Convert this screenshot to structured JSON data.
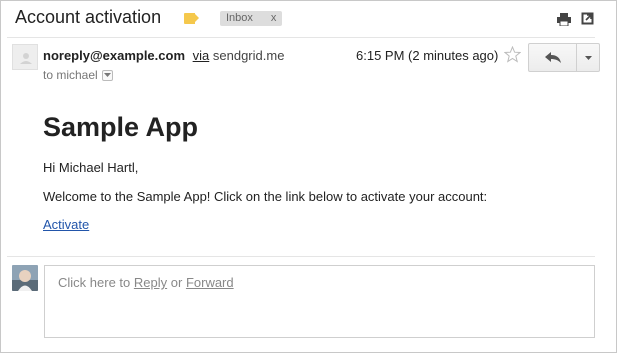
{
  "email": {
    "subject": "Account activation",
    "label_chip": {
      "text": "Inbox",
      "close": "x"
    },
    "sender": {
      "email": "noreply@example.com",
      "via_label": "via",
      "via_domain": "sendgrid.me",
      "to_line": "to michael"
    },
    "timestamp": "6:15 PM (2 minutes ago)"
  },
  "body": {
    "title": "Sample App",
    "greeting": "Hi Michael Hartl,",
    "message": "Welcome to the Sample App! Click on the link below to activate your account:",
    "link_text": "Activate"
  },
  "reply": {
    "prefix": "Click here to",
    "reply_link": "Reply",
    "or": "or",
    "forward_link": "Forward"
  },
  "icons": {
    "label": "label-tag-icon",
    "print": "print-icon",
    "new_window": "new-window-icon",
    "star": "star-icon",
    "reply": "reply-arrow-icon",
    "more": "chevron-down-icon"
  },
  "colors": {
    "label_tag": "#f5c84c",
    "link": "#2255aa",
    "chip_bg": "#dddddd"
  }
}
